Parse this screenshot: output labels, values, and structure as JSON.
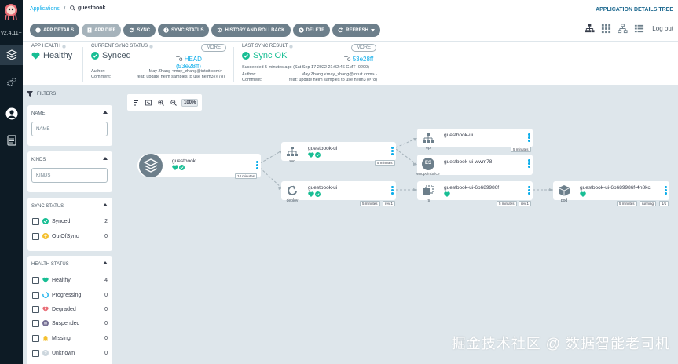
{
  "nav": {
    "version": "v2.4.11+",
    "items": [
      "applications-icon",
      "settings-icon",
      "user-icon",
      "docs-icon"
    ]
  },
  "topbar": {
    "breadcrumb_root": "Applications",
    "breadcrumb_sep": "/",
    "breadcrumb_current": "guestbook",
    "title": "APPLICATION DETAILS TREE",
    "buttons": [
      {
        "label": "APP DETAILS",
        "icon": "info-icon"
      },
      {
        "label": "APP DIFF",
        "icon": "file-diff-icon"
      },
      {
        "label": "SYNC",
        "icon": "sync-icon"
      },
      {
        "label": "SYNC STATUS",
        "icon": "info-icon"
      },
      {
        "label": "HISTORY AND ROLLBACK",
        "icon": "history-icon"
      },
      {
        "label": "DELETE",
        "icon": "times-icon"
      },
      {
        "label": "REFRESH",
        "icon": "redo-icon"
      }
    ],
    "logout": "Log out"
  },
  "status": {
    "app_health": {
      "label": "APP HEALTH",
      "value": "Healthy"
    },
    "current_sync": {
      "label": "CURRENT SYNC STATUS",
      "value": "Synced",
      "more": "MORE",
      "to_prefix": "To",
      "to_ref": "HEAD (53e28ff)",
      "author_label": "Author:",
      "author": "May Zhang <may_zhang@intuit.com> -",
      "comment_label": "Comment:",
      "comment": "feat: update helm samples to use helm3 (#78)"
    },
    "last_sync": {
      "label": "LAST SYNC RESULT",
      "value": "Sync OK",
      "more": "MORE",
      "to_prefix": "To",
      "to_ref": "53e28ff",
      "succeeded": "Succeeded 5 minutes ago (Sat Sep 17 2022 21:02:46 GMT+0200)",
      "author_label": "Author:",
      "author": "May Zhang <may_zhang@intuit.com> -",
      "comment_label": "Comment:",
      "comment": "feat: update helm samples to use helm3 (#78)"
    }
  },
  "filters": {
    "title": "FILTERS",
    "name": {
      "title": "NAME",
      "placeholder": "NAME"
    },
    "kinds": {
      "title": "KINDS",
      "placeholder": "KINDS"
    },
    "sync_status": {
      "title": "SYNC STATUS",
      "items": [
        {
          "label": "Synced",
          "count": "2",
          "icon_color": "#18be94"
        },
        {
          "label": "OutOfSync",
          "count": "0",
          "icon_color": "#f4c030"
        }
      ]
    },
    "health_status": {
      "title": "HEALTH STATUS",
      "items": [
        {
          "label": "Healthy",
          "count": "4",
          "icon_color": "#18be94"
        },
        {
          "label": "Progressing",
          "count": "0",
          "icon_color": "#0dadea"
        },
        {
          "label": "Degraded",
          "count": "0",
          "icon_color": "#e96d76"
        },
        {
          "label": "Suspended",
          "count": "0",
          "icon_color": "#766f94"
        },
        {
          "label": "Missing",
          "count": "0",
          "icon_color": "#f4c030"
        },
        {
          "label": "Unknown",
          "count": "0",
          "icon_color": "#ccd6dd"
        }
      ]
    }
  },
  "toolbar": {
    "zoom": "100%"
  },
  "tree": {
    "app": {
      "name": "guestbook",
      "age": "14 minutes"
    },
    "svc": {
      "name": "guestbook-ui",
      "kind": "svc",
      "age": "5 minutes"
    },
    "deploy": {
      "name": "guestbook-ui",
      "kind": "deploy",
      "age": "5 minutes",
      "rev": "rev:1"
    },
    "ep": {
      "name": "guestbook-ui",
      "kind": "ep",
      "age": "5 minutes"
    },
    "endpointslice": {
      "name": "guestbook-ui-wwm78",
      "kind": "endpointslice",
      "badge": "ES"
    },
    "rs": {
      "name": "guestbook-ui-6b689986f",
      "kind": "rs",
      "age": "5 minutes",
      "rev": "rev:1"
    },
    "pod": {
      "name": "guestbook-ui-6b689986f-4h8kc",
      "kind": "pod",
      "age": "5 minutes",
      "state": "running",
      "ready": "1/1"
    }
  },
  "watermark": "掘金技术社区 @ 数据智能老司机"
}
